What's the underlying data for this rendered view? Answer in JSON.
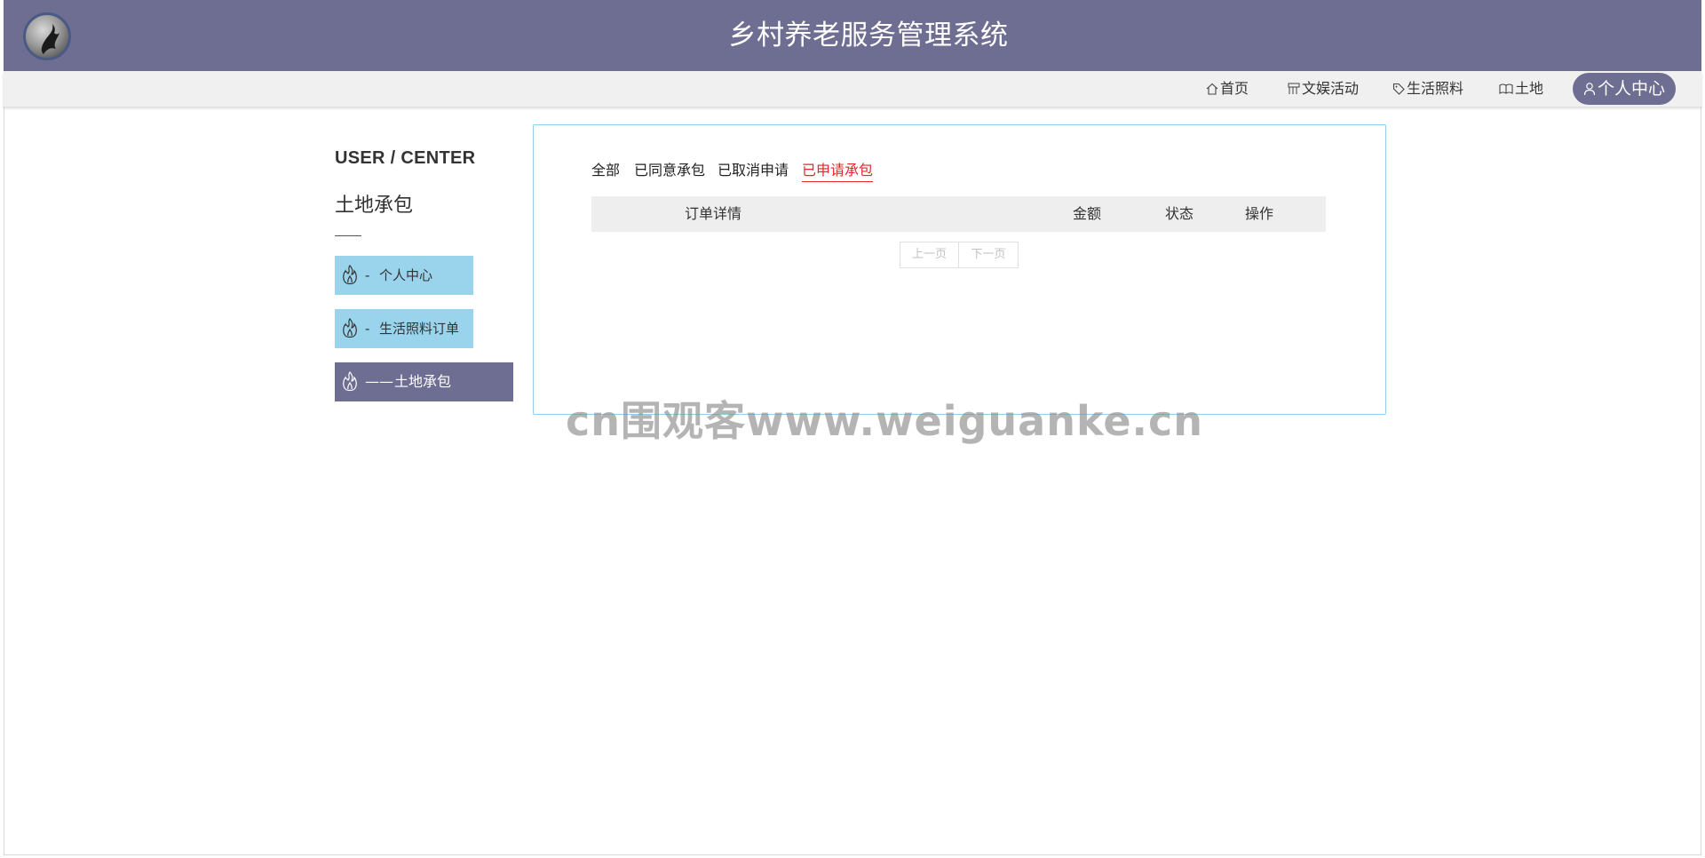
{
  "header": {
    "title": "乡村养老服务管理系统"
  },
  "nav": {
    "home": "首页",
    "entertainment": "文娱活动",
    "care": "生活照料",
    "land": "土地",
    "user_center": "个人中心"
  },
  "sidebar": {
    "heading": "USER / CENTER",
    "subtitle": "土地承包",
    "items": [
      {
        "dash": "-",
        "label": "个人中心"
      },
      {
        "dash": "-",
        "label": "生活照料订单"
      },
      {
        "dash": "——",
        "label": "土地承包"
      }
    ]
  },
  "main": {
    "tabs": [
      {
        "label": "全部"
      },
      {
        "label": "已同意承包"
      },
      {
        "label": "已取消申请"
      },
      {
        "label": "已申请承包"
      }
    ],
    "active_tab": "已申请承包",
    "table_headers": [
      "订单详情",
      "金额",
      "状态",
      "操作"
    ],
    "pager": {
      "prev": "上一页",
      "next": "下一页"
    }
  },
  "watermark": "cn围观客www.weiguanke.cn",
  "colors": {
    "header_bg": "#6e6d92",
    "menu_bg": "#99d4ec",
    "active_tab": "#e8262b",
    "panel_border": "#8fd0ee"
  }
}
